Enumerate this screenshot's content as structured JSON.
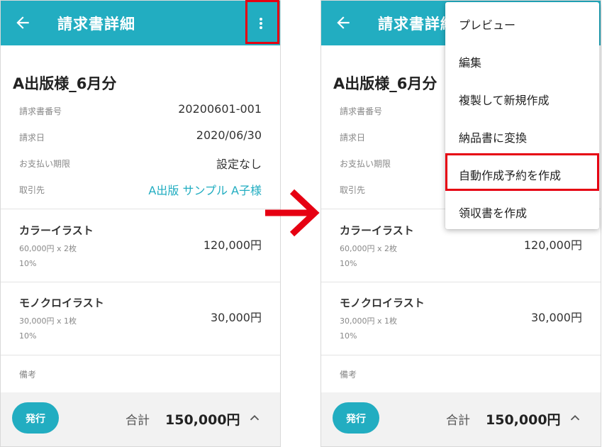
{
  "colors": {
    "accent": "#22adc1",
    "highlight": "#e60012",
    "arrow": "#e60012"
  },
  "appbar": {
    "title": "請求書詳細",
    "back_icon": "arrow-left",
    "more_icon": "more-vert"
  },
  "invoice": {
    "client_title": "A出版様_6月分",
    "fields": [
      {
        "label": "請求書番号",
        "value": "20200601-001"
      },
      {
        "label": "請求日",
        "value": "2020/06/30"
      },
      {
        "label": "お支払い期限",
        "value": "設定なし"
      },
      {
        "label": "取引先",
        "value": "A出版 サンプル A子様"
      }
    ],
    "items": [
      {
        "name": "カラーイラスト",
        "detail": "60,000円 x 2枚",
        "tax": "10%",
        "amount": "120,000円"
      },
      {
        "name": "モノクロイラスト",
        "detail": "30,000円 x 1枚",
        "tax": "10%",
        "amount": "30,000円"
      }
    ],
    "notes_label": "備考"
  },
  "bottom": {
    "issue_label": "発行",
    "total_label": "合計",
    "total_value": "150,000円",
    "expand_icon": "chevron-up"
  },
  "menu": {
    "items": [
      {
        "label": "プレビュー"
      },
      {
        "label": "編集"
      },
      {
        "label": "複製して新規作成"
      },
      {
        "label": "納品書に変換"
      },
      {
        "label": "自動作成予約を作成"
      },
      {
        "label": "領収書を作成"
      }
    ]
  }
}
